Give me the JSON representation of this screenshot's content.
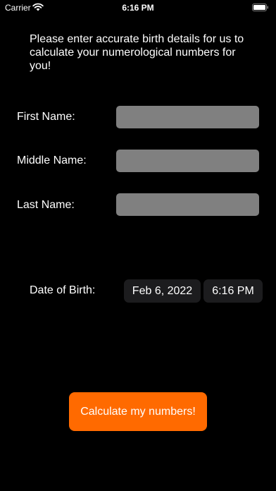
{
  "status_bar": {
    "carrier": "Carrier",
    "time": "6:16 PM",
    "wifi_icon": "wifi-icon",
    "battery_icon": "battery-full-icon"
  },
  "intro": {
    "text": "Please enter accurate birth details for us to calculate your numerological numbers for you!"
  },
  "form": {
    "first_name_label": "First Name:",
    "first_name_value": "",
    "middle_name_label": "Middle Name:",
    "middle_name_value": "",
    "last_name_label": "Last Name:",
    "last_name_value": "",
    "dob_label": "Date of Birth:",
    "dob_date": "Feb 6, 2022",
    "dob_time": "6:16 PM"
  },
  "actions": {
    "calculate_label": "Calculate my numbers!"
  },
  "colors": {
    "background": "#000000",
    "field_fill": "#808080",
    "picker_fill": "#1c1c1e",
    "accent": "#ff6a00"
  }
}
